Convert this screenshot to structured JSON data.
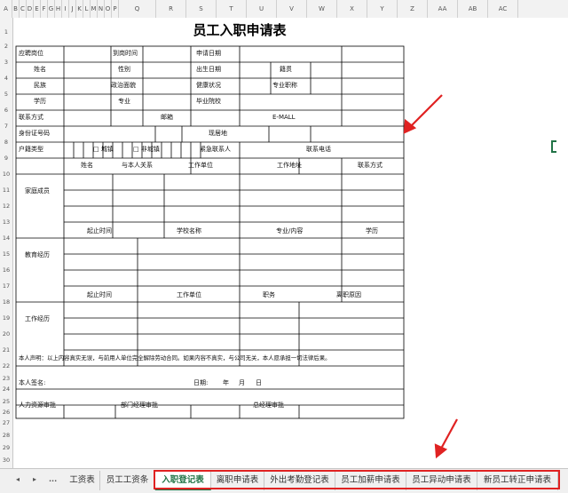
{
  "column_headers": [
    "A",
    "B",
    "C",
    "D",
    "E",
    "F",
    "G",
    "H",
    "I",
    "J",
    "K",
    "L",
    "M",
    "N",
    "O",
    "P",
    "Q",
    "R",
    "S",
    "T",
    "U",
    "V",
    "W",
    "X",
    "Y",
    "Z",
    "AA",
    "AB",
    "AC"
  ],
  "row_headers": [
    "1",
    "2",
    "3",
    "4",
    "5",
    "6",
    "7",
    "8",
    "9",
    "10",
    "11",
    "12",
    "13",
    "14",
    "15",
    "16",
    "17",
    "18",
    "19",
    "20",
    "21",
    "22",
    "23",
    "24",
    "25",
    "26",
    "27",
    "28",
    "29",
    "30"
  ],
  "form": {
    "title": "员工入职申请表",
    "r1": {
      "position": "应聘岗位",
      "arrival": "到岗时间",
      "apply_date": "申请日期"
    },
    "r2": {
      "name": "姓名",
      "gender": "性别",
      "birth": "出生日期",
      "native": "籍贯"
    },
    "r3": {
      "ethnic": "民族",
      "political": "政治面貌",
      "health": "健康状况",
      "title": "专业职称"
    },
    "r4": {
      "education": "学历",
      "major": "专业",
      "school": "毕业院校"
    },
    "r5": {
      "contact": "联系方式",
      "email_label": "邮箱",
      "email": "E-MALL"
    },
    "r6": {
      "id": "身份证号码",
      "address": "现居地"
    },
    "r7": {
      "hukou": "户籍类型",
      "urban": "□ 城镇",
      "rural": "□ 非城镇",
      "emergency": "紧急联系人",
      "phone": "联系电话"
    },
    "family": {
      "section": "家庭成员",
      "headers": [
        "姓名",
        "与本人关系",
        "工作单位",
        "工作地址",
        "联系方式"
      ]
    },
    "edu": {
      "section": "教育经历",
      "headers": [
        "起止时间",
        "学校名称",
        "专业/内容",
        "学历"
      ]
    },
    "work": {
      "section": "工作经历",
      "headers": [
        "起止时间",
        "工作单位",
        "职务",
        "离职原因"
      ]
    },
    "declaration": "本人声明：以上内容真实无误，与前用人单位完全解除劳动合同。如果内容不真实，与公司无关，本人愿承担一切法律后果。",
    "sign": "本人签名:",
    "date_label": "日期:",
    "year": "年",
    "month": "月",
    "day": "日",
    "hr": "人力资源审批",
    "dept": "部门经理审批",
    "gm": "总经理审批"
  },
  "tabs": {
    "nav_first": "◂",
    "nav_last": "▸",
    "ellipsis": "...",
    "items": [
      "工资表",
      "员工工资条",
      "入职登记表",
      "离职申请表",
      "外出考勤登记表",
      "员工加薪申请表",
      "员工异动申请表",
      "新员工转正申请表"
    ],
    "active_index": 2
  },
  "colors": {
    "annotation": "#e02222",
    "excel_green": "#217346"
  }
}
